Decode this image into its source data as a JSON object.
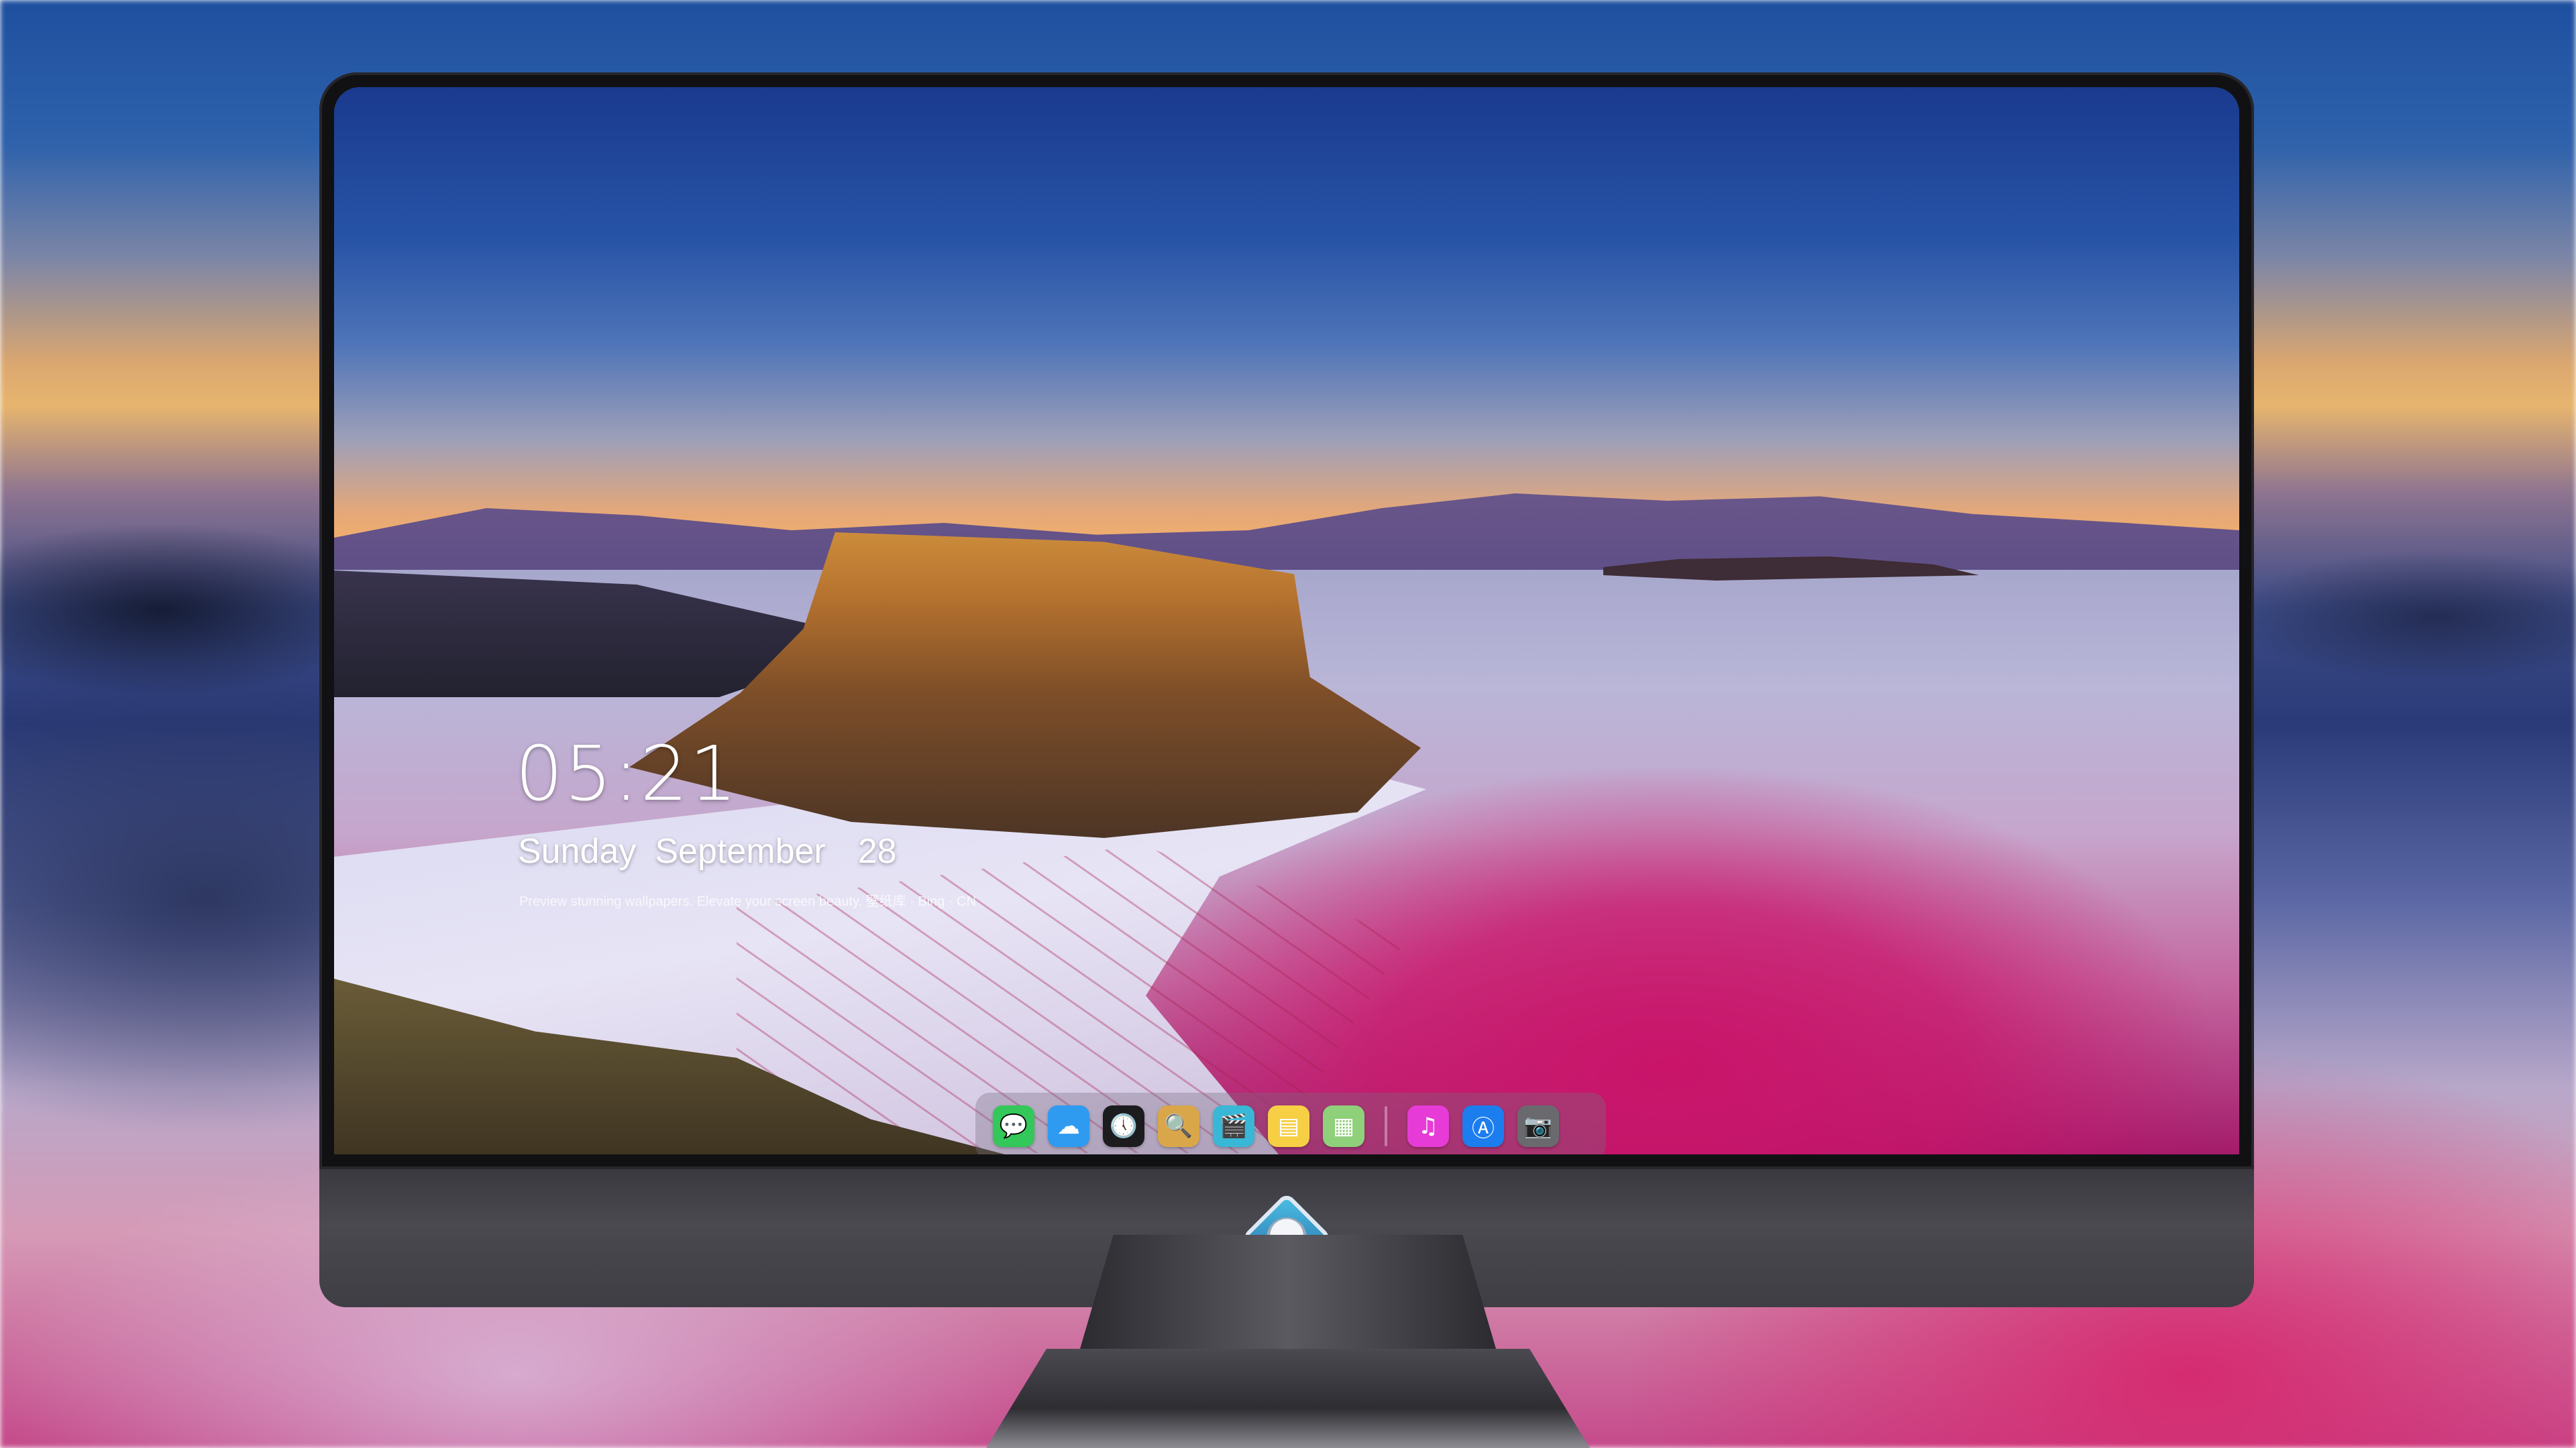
{
  "lockscreen": {
    "time": "05:21",
    "date": {
      "weekday": "Sunday",
      "month": "September",
      "day": "28"
    },
    "caption": "Preview stunning wallpapers. Elevate your screen beauty. 壁纸库 · Bing · CN"
  },
  "dock": {
    "apps": [
      {
        "name": "Messages",
        "icon": "message-bubble-icon",
        "glyph": "💬",
        "color": "#34c759"
      },
      {
        "name": "Weather",
        "icon": "weather-cloud-icon",
        "glyph": "☁",
        "color": "#2e9bf0"
      },
      {
        "name": "Clock",
        "icon": "clock-icon",
        "glyph": "🕔",
        "color": "#1c1c1e"
      },
      {
        "name": "Preview",
        "icon": "preview-icon",
        "glyph": "🔍",
        "color": "#d9a74a"
      },
      {
        "name": "Videos",
        "icon": "clapperboard-icon",
        "glyph": "🎬",
        "color": "#39b7d6"
      },
      {
        "name": "Notes",
        "icon": "notes-icon",
        "glyph": "▤",
        "color": "#f6cf45"
      },
      {
        "name": "Photos",
        "icon": "photos-icon",
        "glyph": "▦",
        "color": "#8fd07a"
      },
      {
        "name": "Music",
        "icon": "music-note-icon",
        "glyph": "♫",
        "color": "#e63bd6"
      },
      {
        "name": "App Store",
        "icon": "app-store-icon",
        "glyph": "Ⓐ",
        "color": "#1c7dee"
      },
      {
        "name": "Camera",
        "icon": "camera-icon",
        "glyph": "📷",
        "color": "#6a6a6e"
      }
    ]
  },
  "colors": {
    "bezel": "#111114",
    "chin": "#4a4950",
    "accent_magenta": "#c9146a"
  }
}
